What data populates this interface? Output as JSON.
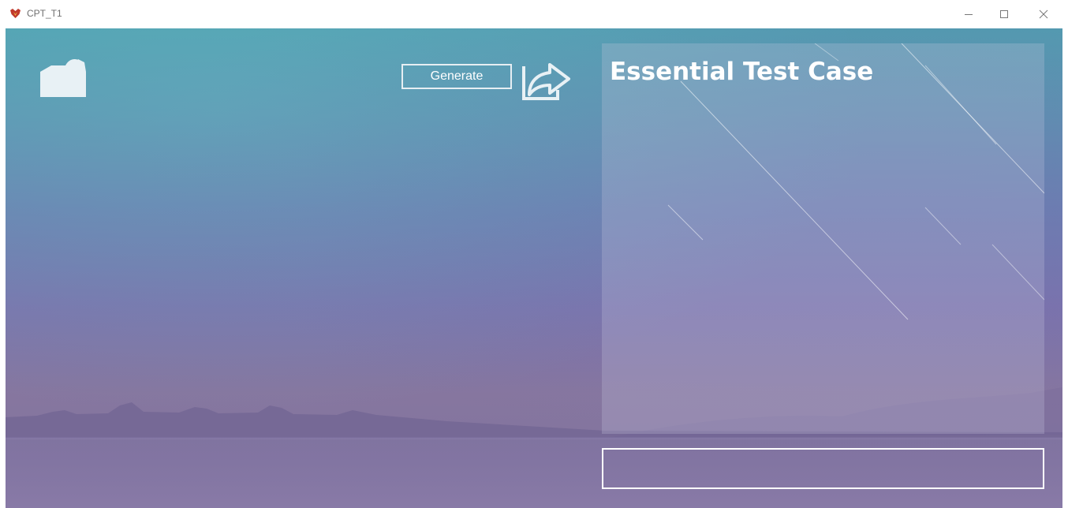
{
  "window": {
    "title": "CPT_T1",
    "controls": [
      "minimize",
      "maximize",
      "close"
    ]
  },
  "toolbar": {
    "open_icon": "folder-icon",
    "generate_label": "Generate",
    "export_icon": "export-arrow-icon"
  },
  "panel": {
    "title": "Essential Test Case"
  },
  "output": {
    "value": ""
  },
  "colors": {
    "bg_top": "#4f9fb0",
    "bg_mid": "#6a7fb0",
    "bg_bottom": "#86769f",
    "foreground": "#ffffff"
  }
}
